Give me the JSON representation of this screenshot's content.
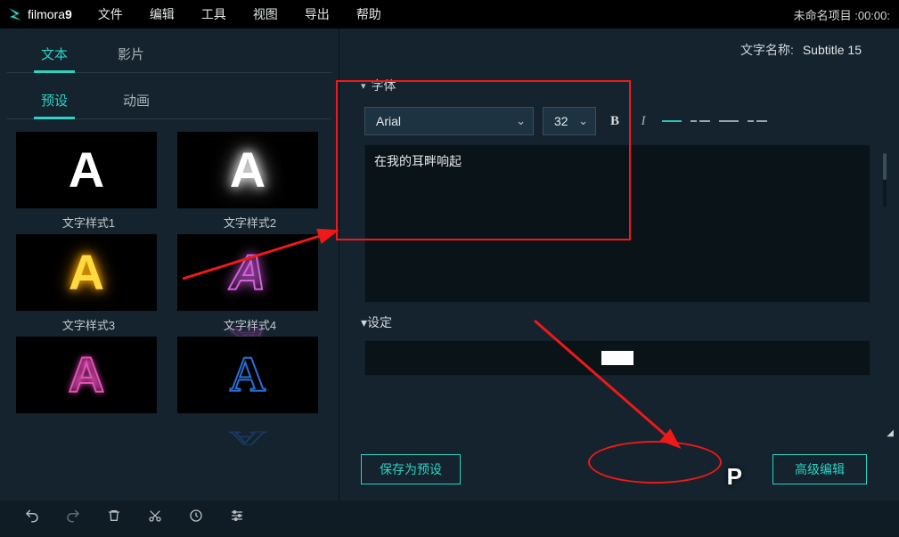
{
  "app": {
    "name": "filmora",
    "version": "9"
  },
  "menubar": {
    "items": [
      "文件",
      "编辑",
      "工具",
      "视图",
      "导出",
      "帮助"
    ],
    "project_name": "未命名项目",
    "timestamp": ":00:00:"
  },
  "leftPanel": {
    "tabs": {
      "text": "文本",
      "clip": "影片"
    },
    "subtabs": {
      "preset": "预设",
      "anim": "动画"
    },
    "presets": [
      {
        "label": "文字样式1"
      },
      {
        "label": "文字样式2"
      },
      {
        "label": "文字样式3"
      },
      {
        "label": "文字样式4"
      },
      {
        "label": ""
      },
      {
        "label": ""
      }
    ]
  },
  "rightPanel": {
    "name_label": "文字名称:",
    "name_value": "Subtitle 15",
    "font_section": "字体",
    "font_family": "Arial",
    "font_size": "32",
    "text_content": "在我的耳畔响起",
    "settings_section": "设定"
  },
  "actions": {
    "save_preset": "保存为预设",
    "advanced_edit": "高级编辑"
  }
}
